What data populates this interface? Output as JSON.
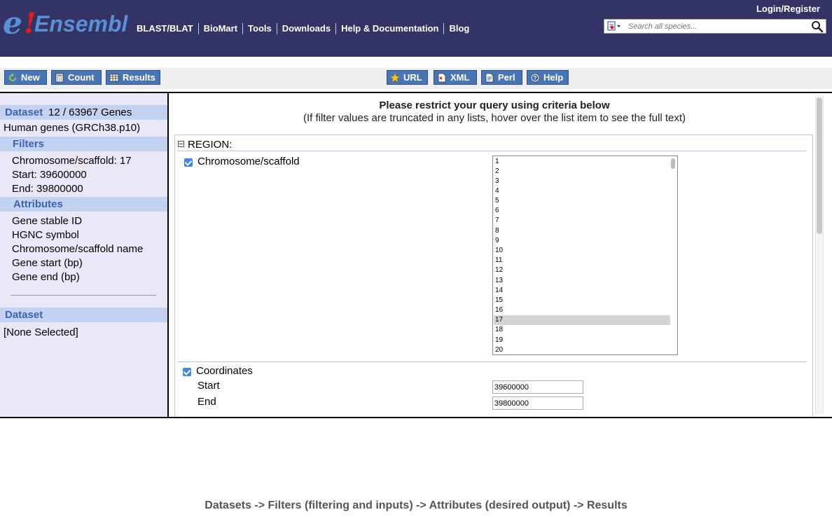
{
  "header": {
    "logo": {
      "e": "e",
      "bang": "!",
      "text": "Ensembl"
    },
    "nav": [
      "BLAST/BLAT",
      "BioMart",
      "Tools",
      "Downloads",
      "Help & Documentation",
      "Blog"
    ],
    "login": "Login/Register",
    "search_placeholder": "Search all species..."
  },
  "toolbar": {
    "left": [
      "New",
      "Count",
      "Results"
    ],
    "right": [
      "URL",
      "XML",
      "Perl",
      "Help"
    ]
  },
  "sidebar": {
    "dataset_label": "Dataset",
    "dataset_value": "12 / 63967 Genes",
    "dataset_name": "Human genes (GRCh38.p10)",
    "filters_label": "Filters",
    "filters": [
      "Chromosome/scaffold: 17",
      "Start: 39600000",
      "End: 39800000"
    ],
    "attributes_label": "Attributes",
    "attributes": [
      "Gene stable ID",
      "HGNC symbol",
      "Chromosome/scaffold name",
      "Gene start (bp)",
      "Gene end (bp)"
    ],
    "dataset2_label": "Dataset",
    "dataset2_value": "[None Selected]"
  },
  "main": {
    "title": "Please restrict your query using criteria below",
    "subtitle": "(If filter values are truncated in any lists, hover over the list item to see the full text)",
    "region_label": "REGION:",
    "chromosome_label": "Chromosome/scaffold",
    "chromosome_options": [
      "1",
      "2",
      "3",
      "4",
      "5",
      "6",
      "7",
      "8",
      "9",
      "10",
      "11",
      "12",
      "13",
      "14",
      "15",
      "16",
      "17",
      "18",
      "19",
      "20"
    ],
    "chromosome_selected": "17",
    "coordinates_label": "Coordinates",
    "start_label": "Start",
    "start_value": "39600000",
    "end_label": "End",
    "end_value": "39800000"
  },
  "footer": "Datasets -> Filters (filtering and inputs) -> Attributes (desired output) -> Results"
}
